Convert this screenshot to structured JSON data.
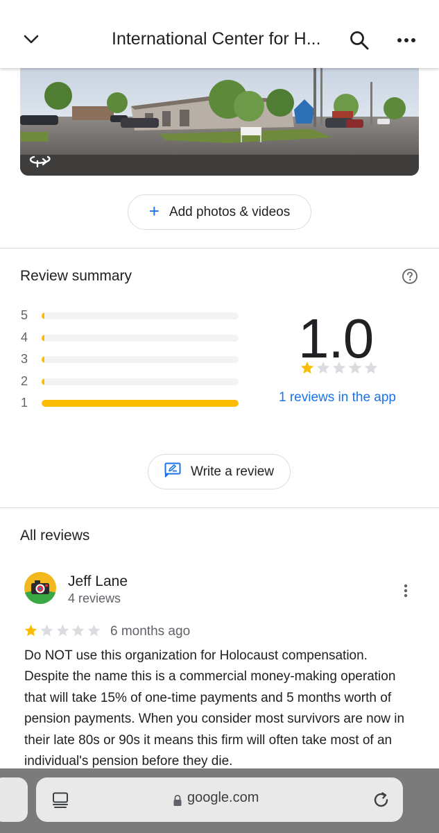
{
  "header": {
    "title": "International Center for H...",
    "back_icon": "chevron-down-icon",
    "search_icon": "search-icon",
    "more_icon": "more-horizontal-icon"
  },
  "photo": {
    "overlay_icon": "360-rotate-icon"
  },
  "add_photos": {
    "label": "Add photos & videos",
    "plus": "+"
  },
  "review_summary": {
    "title": "Review summary",
    "help_icon": "help-circle-icon",
    "distribution": [
      {
        "stars": "5",
        "fraction": 0.0
      },
      {
        "stars": "4",
        "fraction": 0.0
      },
      {
        "stars": "3",
        "fraction": 0.0
      },
      {
        "stars": "2",
        "fraction": 0.0
      },
      {
        "stars": "1",
        "fraction": 1.0
      }
    ],
    "rating": "1.0",
    "stars_filled": 1,
    "stars_total": 5,
    "reviews_link": "1 reviews in the app"
  },
  "write_review": {
    "label": "Write a review",
    "icon": "edit-review-icon"
  },
  "all_reviews": {
    "title": "All reviews",
    "reviews": [
      {
        "name": "Jeff Lane",
        "count": "4 reviews",
        "stars_filled": 1,
        "time": "6 months ago",
        "text": "Do NOT use this organization for Holocaust compensation. Despite the name this is a commercial money-making operation that will take 15% of one-time payments and 5 months worth of pension payments. When you consider most survivors are now in their late 80s or 90s it means this firm will often take most of an individual's pension before they die."
      }
    ]
  },
  "browser": {
    "url": "google.com",
    "tabs_icon": "tabs-icon",
    "lock_icon": "lock-icon",
    "reload_icon": "reload-icon"
  },
  "colors": {
    "accent": "#1a73e8",
    "star": "#fbbc04",
    "star_empty": "#dadce0",
    "divider": "#dadce0"
  }
}
